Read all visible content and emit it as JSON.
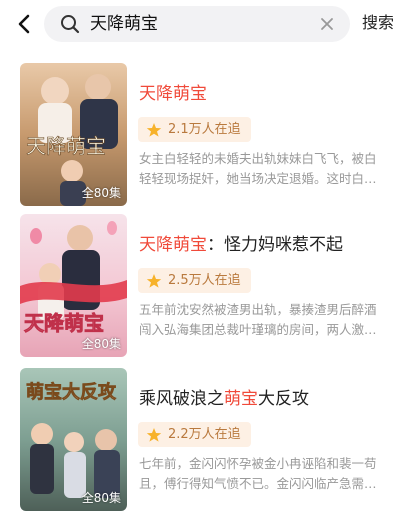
{
  "search": {
    "query": "天降萌宝",
    "button_label": "搜索"
  },
  "icons": {
    "back": "back-arrow-icon",
    "search": "search-icon",
    "clear": "clear-icon",
    "star": "star-icon"
  },
  "colors": {
    "highlight": "#f04a3a",
    "badge_bg": "#fdf0e4",
    "badge_text": "#b9793d",
    "star": "#f7b22a"
  },
  "results": [
    {
      "title_hl": "天降萌宝",
      "title_rest": "",
      "popularity": "2.1万人在追",
      "desc_line1": "女主白轻轻的未婚夫出轨妹妹白飞飞，被白",
      "desc_line2": "轻轻现场捉奸，她当场决定退婚。这时白…",
      "cover_title": "天降萌宝",
      "episodes": "全80集"
    },
    {
      "title_hl": "天降萌宝",
      "title_rest": "：怪力妈咪惹不起",
      "popularity": "2.5万人在追",
      "desc_line1": "五年前沈安然被渣男出轨，暴揍渣男后醉酒",
      "desc_line2": "闯入弘海集团总裁叶瑾璃的房间，两人激…",
      "cover_title": "天降萌宝",
      "episodes": "全80集"
    },
    {
      "title_pre": "乘风破浪之",
      "title_hl": "萌宝",
      "title_post": "大反攻",
      "popularity": "2.2万人在追",
      "desc_line1": "七年前，金闪闪怀孕被金小冉诬陷和裴一苟",
      "desc_line2": "且，傅行得知气愤不已。金闪闪临产急需…",
      "cover_title": "萌宝大反攻",
      "episodes": "全80集"
    }
  ]
}
